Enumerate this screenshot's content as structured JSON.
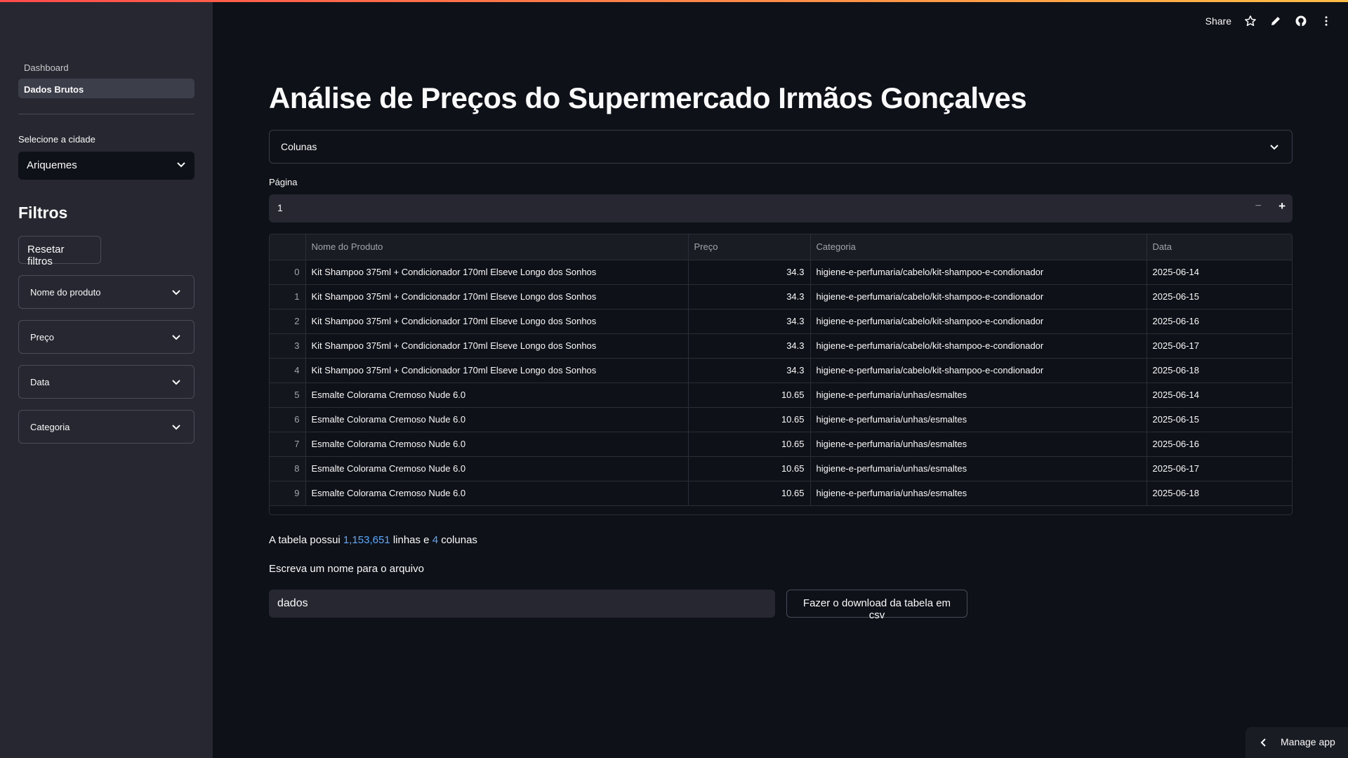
{
  "sidebar": {
    "nav": [
      {
        "label": "Dashboard",
        "active": false
      },
      {
        "label": "Dados Brutos",
        "active": true
      }
    ],
    "city_label": "Selecione a cidade",
    "city_value": "Ariquemes",
    "filters_title": "Filtros",
    "reset_label": "Resetar filtros",
    "expanders": [
      "Nome do produto",
      "Preço",
      "Data",
      "Categoria"
    ]
  },
  "toolbar": {
    "share_label": "Share",
    "icons": [
      "star-icon",
      "edit-icon",
      "github-icon",
      "more-icon"
    ]
  },
  "main": {
    "title": "Análise de Preços do Supermercado Irmãos Gonçalves",
    "columns_label": "Colunas",
    "page_label": "Página",
    "page_value": "1",
    "table": {
      "headers": [
        "",
        "Nome do Produto",
        "Preço",
        "Categoria",
        "Data"
      ],
      "rows": [
        [
          "0",
          "Kit Shampoo 375ml + Condicionador 170ml Elseve Longo dos Sonhos",
          "34.3",
          "higiene-e-perfumaria/cabelo/kit-shampoo-e-condionador",
          "2025-06-14"
        ],
        [
          "1",
          "Kit Shampoo 375ml + Condicionador 170ml Elseve Longo dos Sonhos",
          "34.3",
          "higiene-e-perfumaria/cabelo/kit-shampoo-e-condionador",
          "2025-06-15"
        ],
        [
          "2",
          "Kit Shampoo 375ml + Condicionador 170ml Elseve Longo dos Sonhos",
          "34.3",
          "higiene-e-perfumaria/cabelo/kit-shampoo-e-condionador",
          "2025-06-16"
        ],
        [
          "3",
          "Kit Shampoo 375ml + Condicionador 170ml Elseve Longo dos Sonhos",
          "34.3",
          "higiene-e-perfumaria/cabelo/kit-shampoo-e-condionador",
          "2025-06-17"
        ],
        [
          "4",
          "Kit Shampoo 375ml + Condicionador 170ml Elseve Longo dos Sonhos",
          "34.3",
          "higiene-e-perfumaria/cabelo/kit-shampoo-e-condionador",
          "2025-06-18"
        ],
        [
          "5",
          "Esmalte Colorama Cremoso Nude 6.0",
          "10.65",
          "higiene-e-perfumaria/unhas/esmaltes",
          "2025-06-14"
        ],
        [
          "6",
          "Esmalte Colorama Cremoso Nude 6.0",
          "10.65",
          "higiene-e-perfumaria/unhas/esmaltes",
          "2025-06-15"
        ],
        [
          "7",
          "Esmalte Colorama Cremoso Nude 6.0",
          "10.65",
          "higiene-e-perfumaria/unhas/esmaltes",
          "2025-06-16"
        ],
        [
          "8",
          "Esmalte Colorama Cremoso Nude 6.0",
          "10.65",
          "higiene-e-perfumaria/unhas/esmaltes",
          "2025-06-17"
        ],
        [
          "9",
          "Esmalte Colorama Cremoso Nude 6.0",
          "10.65",
          "higiene-e-perfumaria/unhas/esmaltes",
          "2025-06-18"
        ]
      ]
    },
    "info": {
      "prefix": "A tabela possui ",
      "rows_count": "1,153,651",
      "middle": " linhas e ",
      "cols_count": "4",
      "suffix": " colunas"
    },
    "filename_label": "Escreva um nome para o arquivo",
    "filename_value": "dados",
    "download_label": "Fazer o download da tabela em csv"
  },
  "manage_app_label": "Manage app",
  "colors": {
    "background": "#0e1117",
    "sidebar": "#262730",
    "accent_start": "#ff4b4b",
    "accent_end": "#ffbd45",
    "link": "#5aa9ff"
  }
}
